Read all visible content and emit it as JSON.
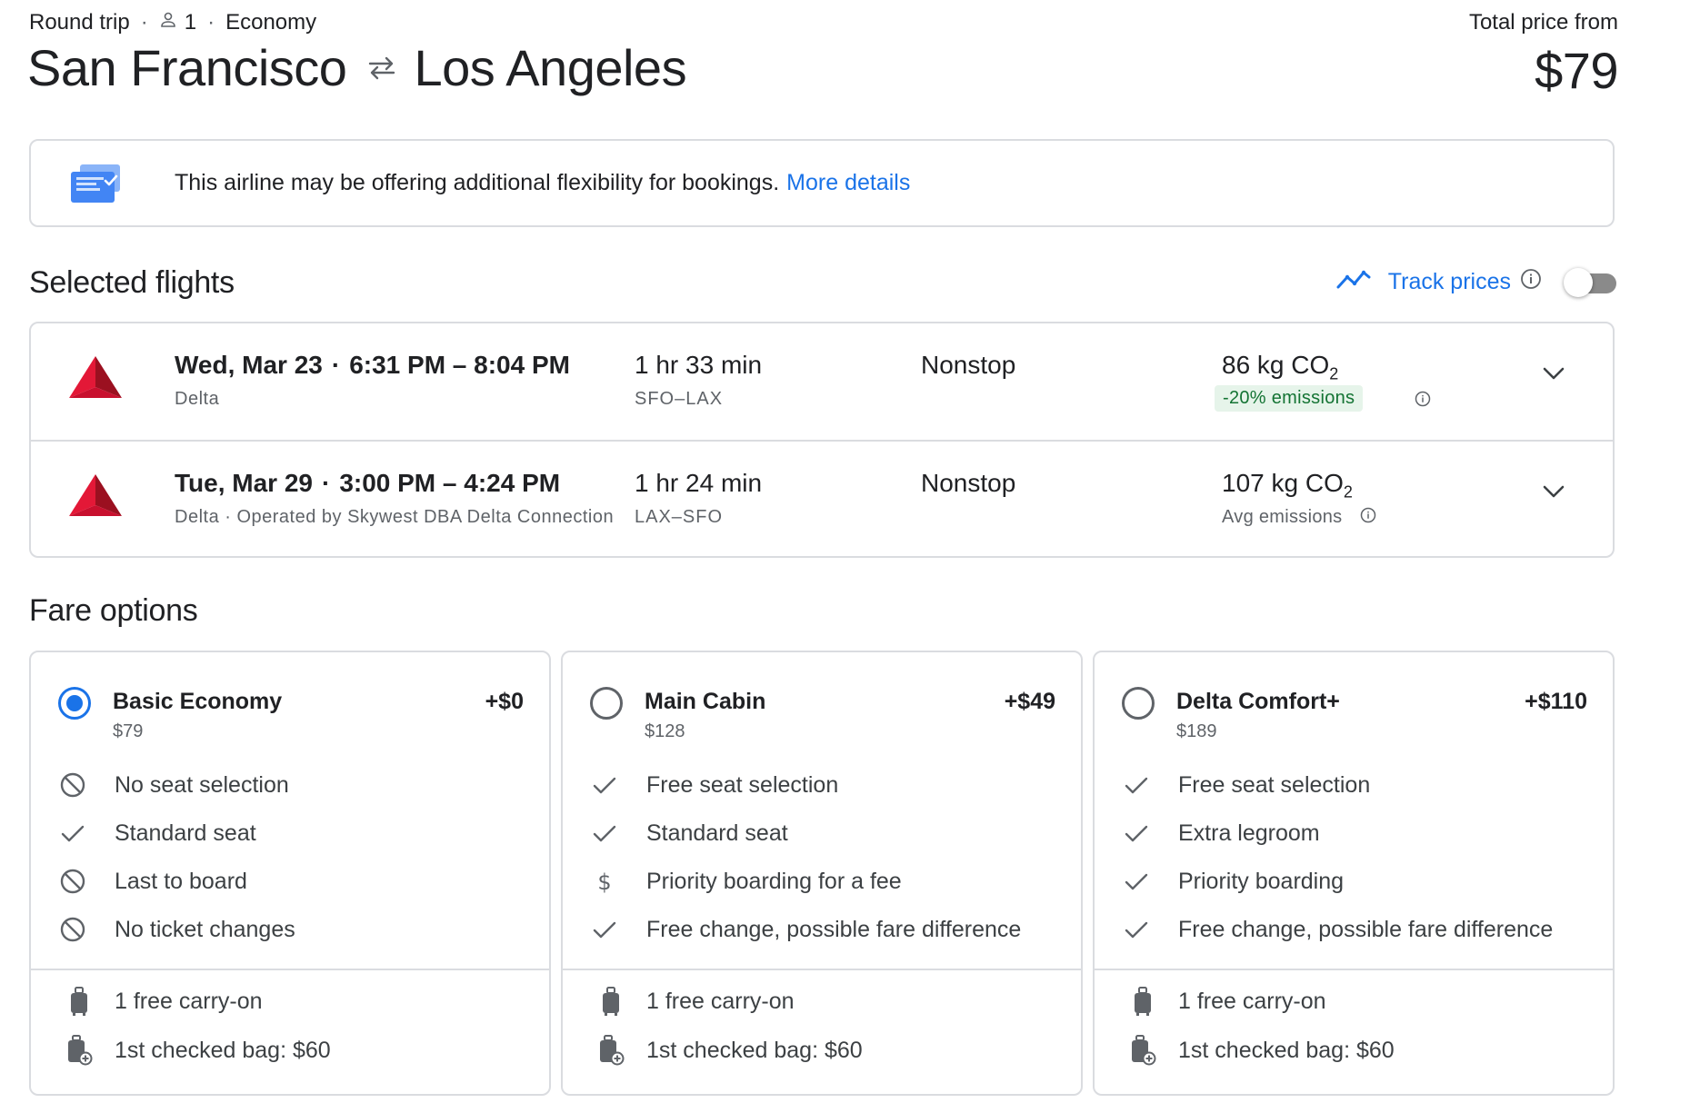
{
  "trip": {
    "type": "Round trip",
    "passengers": "1",
    "cabin": "Economy"
  },
  "route": {
    "origin": "San Francisco",
    "destination": "Los Angeles"
  },
  "total": {
    "label": "Total price from",
    "amount": "$79"
  },
  "notice": {
    "text": "This airline may be offering additional flexibility for bookings.",
    "link": "More details"
  },
  "selected": {
    "title": "Selected flights",
    "track_label": "Track prices"
  },
  "flights": [
    {
      "date": "Wed, Mar 23",
      "times": "6:31 PM – 8:04 PM",
      "airline": "Delta",
      "duration": "1 hr 33 min",
      "airports": "SFO–LAX",
      "stops": "Nonstop",
      "co2": "86 kg CO",
      "emissions": "-20% emissions"
    },
    {
      "date": "Tue, Mar 29",
      "times": "3:00 PM – 4:24 PM",
      "airline": "Delta · Operated by Skywest DBA Delta Connection",
      "duration": "1 hr 24 min",
      "airports": "LAX–SFO",
      "stops": "Nonstop",
      "co2": "107 kg CO",
      "emissions": "Avg emissions"
    }
  ],
  "fare_section": {
    "title": "Fare options"
  },
  "fares": [
    {
      "name": "Basic Economy",
      "price": "$79",
      "delta": "+$0",
      "selected": true,
      "features": [
        {
          "icon": "no-icon",
          "text": "No seat selection"
        },
        {
          "icon": "check-icon",
          "text": "Standard seat"
        },
        {
          "icon": "no-icon",
          "text": "Last to board"
        },
        {
          "icon": "no-icon",
          "text": "No ticket changes"
        }
      ],
      "bags": [
        "1 free carry-on",
        "1st checked bag: $60"
      ]
    },
    {
      "name": "Main Cabin",
      "price": "$128",
      "delta": "+$49",
      "selected": false,
      "features": [
        {
          "icon": "check-icon",
          "text": "Free seat selection"
        },
        {
          "icon": "check-icon",
          "text": "Standard seat"
        },
        {
          "icon": "dollar-icon",
          "text": "Priority boarding for a fee"
        },
        {
          "icon": "check-icon",
          "text": "Free change, possible fare difference"
        }
      ],
      "bags": [
        "1 free carry-on",
        "1st checked bag: $60"
      ]
    },
    {
      "name": "Delta Comfort+",
      "price": "$189",
      "delta": "+$110",
      "selected": false,
      "features": [
        {
          "icon": "check-icon",
          "text": "Free seat selection"
        },
        {
          "icon": "check-icon",
          "text": "Extra legroom"
        },
        {
          "icon": "check-icon",
          "text": "Priority boarding"
        },
        {
          "icon": "check-icon",
          "text": "Free change, possible fare difference"
        }
      ],
      "bags": [
        "1 free carry-on",
        "1st checked bag: $60"
      ]
    }
  ],
  "colors": {
    "accent": "#1a73e8",
    "delta_red": "#c8102e",
    "green_badge_bg": "#e6f4ea",
    "green_badge_text": "#137333",
    "border": "#dadce0"
  }
}
